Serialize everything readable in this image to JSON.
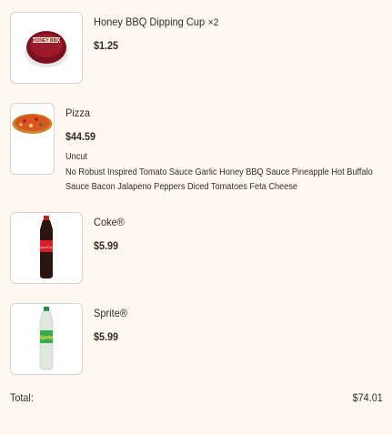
{
  "cart": {
    "items": [
      {
        "name": "Honey BBQ Dipping Cup",
        "qty": "×2",
        "price": "$1.25",
        "image": "honey-bbq-cup-image"
      },
      {
        "name": "Pizza",
        "price": "$44.59",
        "crust": "Uncut",
        "toppings": "No Robust Inspired Tomato Sauce Garlic Honey BBQ Sauce Pineapple Hot Buffalo Sauce Bacon Jalapeno Peppers Diced Tomatoes Feta Cheese",
        "image": "pizza-image"
      },
      {
        "name": "Coke®",
        "price": "$5.99",
        "image": "coke-bottle-image"
      },
      {
        "name": "Sprite®",
        "price": "$5.99",
        "image": "sprite-bottle-image"
      }
    ],
    "total_label": "Total:",
    "total_value": "$74.01"
  }
}
